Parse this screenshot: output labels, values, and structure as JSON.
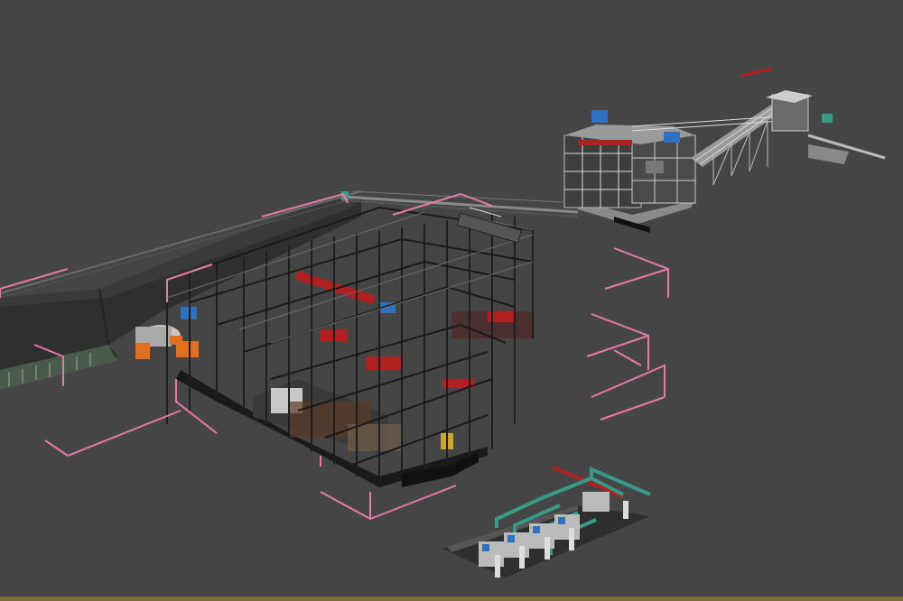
{
  "viewport": {
    "view_type": "perspective-3d",
    "background_color": "#454545",
    "bracket_color": "#e87aa8",
    "frame_color": "#1f1f1f",
    "pipe_color": "#3a9a8a",
    "accent_red": "#b02020",
    "accent_orange": "#e07020",
    "accent_blue": "#3070c0"
  },
  "scene_objects": [
    {
      "name": "mill-building-wireframe",
      "selected": true
    },
    {
      "name": "crusher-tower",
      "selected": false
    },
    {
      "name": "long-conveyor-shed",
      "selected": true
    },
    {
      "name": "pump-station",
      "selected": false
    }
  ]
}
